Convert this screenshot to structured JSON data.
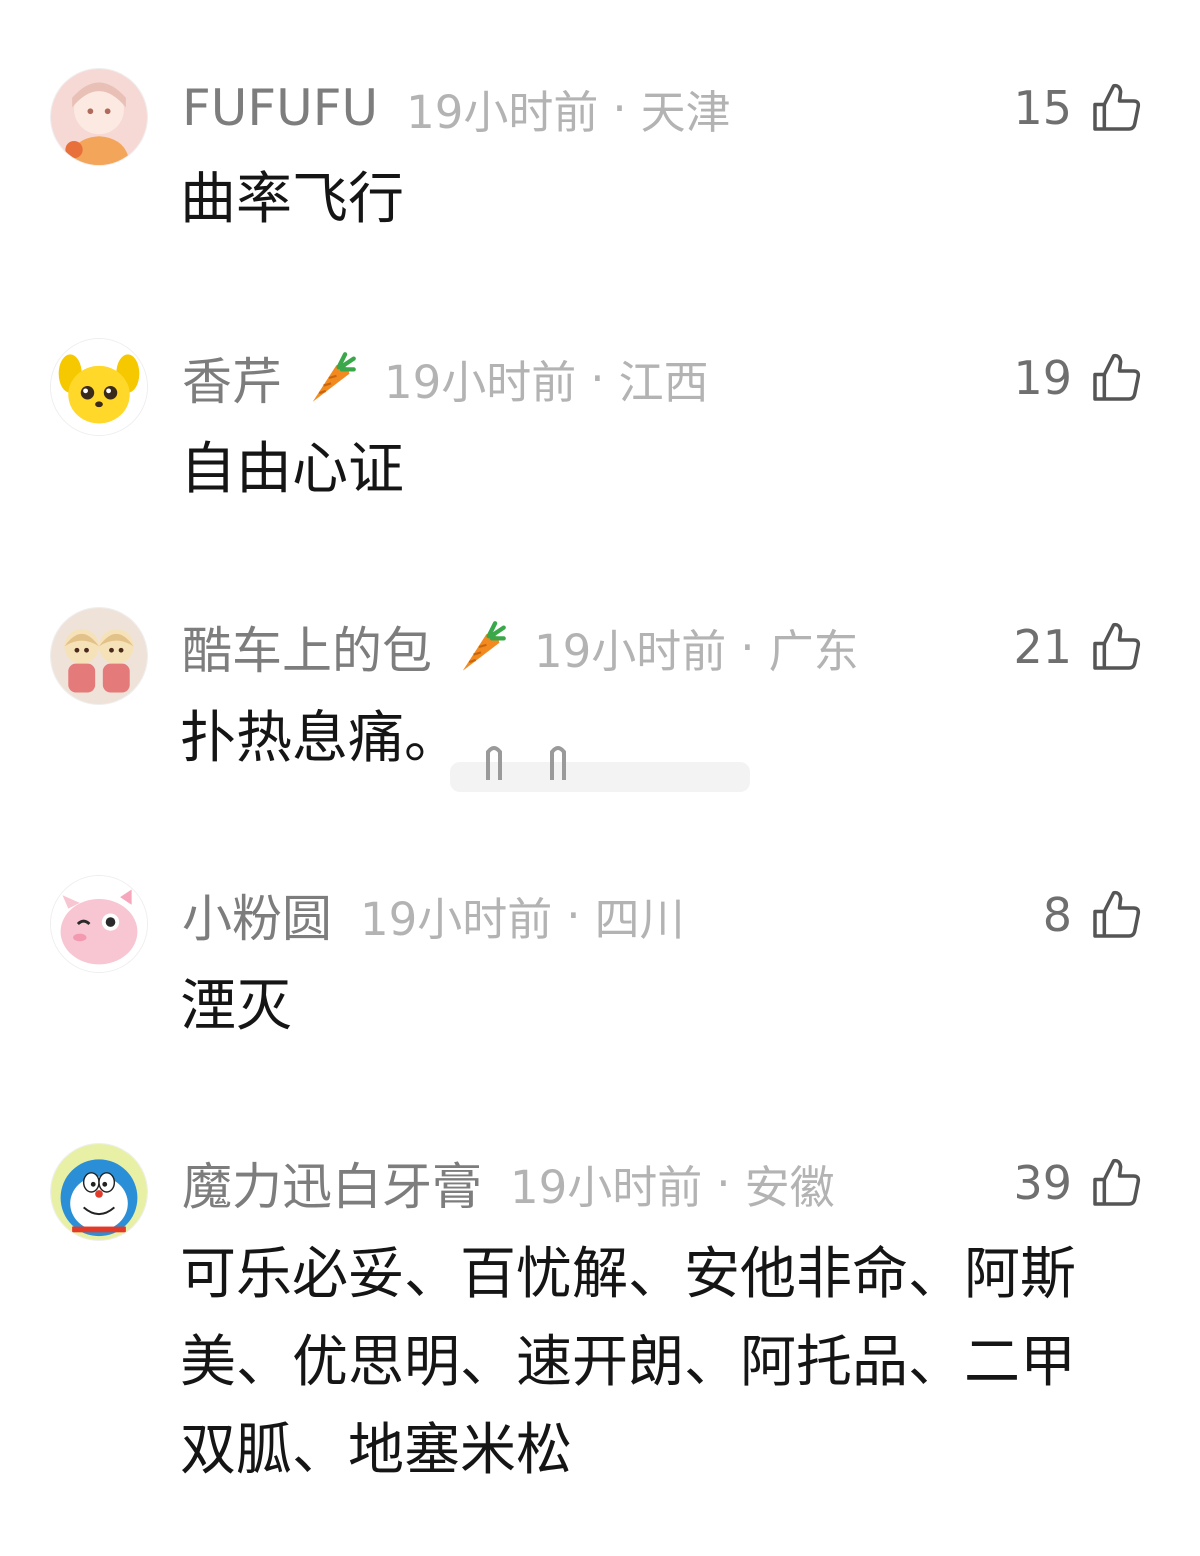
{
  "colors": {
    "username": "#7d7d7d",
    "meta": "#b3b3b3",
    "like_count": "#6f6f6f",
    "body_text": "#151515",
    "carrot_orange": "#f28a1f",
    "carrot_green": "#3aa84a"
  },
  "comments": [
    {
      "username": "FUFUFU",
      "badge": null,
      "time": "19小时前",
      "separator": "·",
      "location": "天津",
      "likes": "15",
      "text": "曲率飞行",
      "avatar_icon": "anime-girl-avatar"
    },
    {
      "username": "香芹",
      "badge": "carrot-icon",
      "time": "19小时前",
      "separator": "·",
      "location": "江西",
      "likes": "19",
      "text": "自由心证",
      "avatar_icon": "yellow-dog-avatar"
    },
    {
      "username": "酷车上的包",
      "badge": "carrot-icon",
      "time": "19小时前",
      "separator": "·",
      "location": "广东",
      "likes": "21",
      "text": "扑热息痛。",
      "avatar_icon": "twin-dolls-avatar"
    },
    {
      "username": "小粉圆",
      "badge": null,
      "time": "19小时前",
      "separator": "·",
      "location": "四川",
      "likes": "8",
      "text": "湮灭",
      "avatar_icon": "pink-blob-avatar"
    },
    {
      "username": "魔力迅白牙膏",
      "badge": null,
      "time": "19小时前",
      "separator": "·",
      "location": "安徽",
      "likes": "39",
      "text": "可乐必妥、百忧解、安他非命、阿斯美、优思明、速开朗、阿托品、二甲双胍、地塞米松",
      "avatar_icon": "doraemon-avatar"
    }
  ]
}
